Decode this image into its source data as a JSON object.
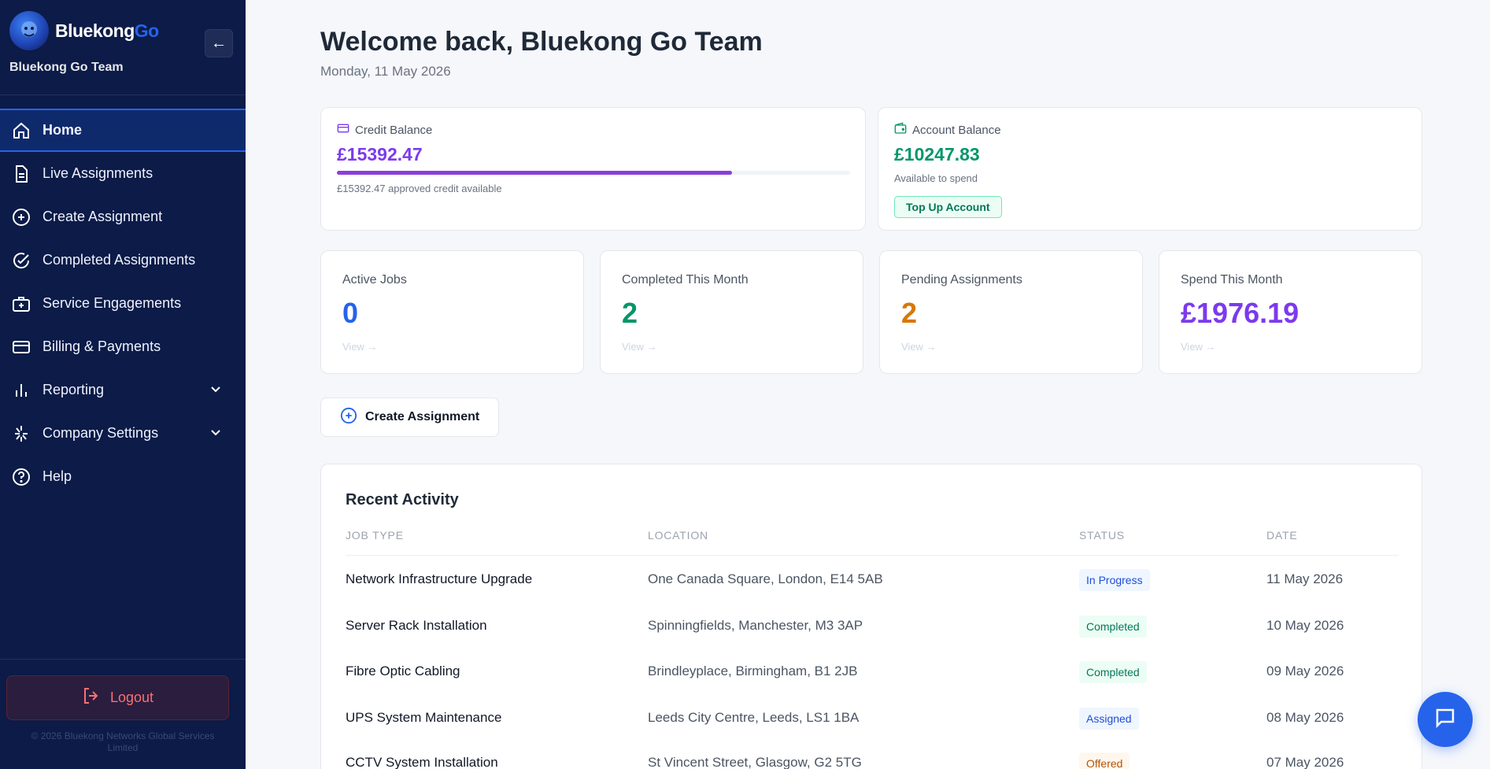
{
  "colors": {
    "sidebar_bg": "#0c1b47",
    "accent_blue": "#2563eb",
    "purple": "#7c3aed",
    "green": "#059669",
    "orange": "#d97706"
  },
  "sidebar": {
    "brand_primary": "Bluekong",
    "brand_accent": "Go",
    "team_name": "Bluekong Go Team",
    "collapse_label": "←",
    "items": [
      {
        "label": "Home",
        "icon": "home-icon",
        "active": true
      },
      {
        "label": "Live Assignments",
        "icon": "document-icon"
      },
      {
        "label": "Create Assignment",
        "icon": "plus-circle-icon"
      },
      {
        "label": "Completed Assignments",
        "icon": "check-circle-icon"
      },
      {
        "label": "Service Engagements",
        "icon": "briefcase-plus-icon"
      },
      {
        "label": "Billing & Payments",
        "icon": "credit-card-icon"
      },
      {
        "label": "Reporting",
        "icon": "bar-chart-icon",
        "expandable": true
      },
      {
        "label": "Company Settings",
        "icon": "settings-icon",
        "expandable": true
      },
      {
        "label": "Help",
        "icon": "help-circle-icon"
      }
    ],
    "logout_label": "Logout",
    "copyright_line1": "© 2026 Bluekong Networks Global Services",
    "copyright_line2": "Limited"
  },
  "header": {
    "welcome": "Welcome back, Bluekong Go Team",
    "date": "Monday, 11 May 2026"
  },
  "credit": {
    "label": "Credit Balance",
    "value": "£15392.47",
    "progress_fraction": 0.77,
    "sub": "£15392.47 approved credit available"
  },
  "account": {
    "label": "Account Balance",
    "value": "£10247.83",
    "sub": "Available to spend",
    "topup_label": "Top Up Account"
  },
  "stats": [
    {
      "label": "Active Jobs",
      "value": "0",
      "link": "View →",
      "color": "#2563eb"
    },
    {
      "label": "Completed This Month",
      "value": "2",
      "link": "View →",
      "color": "#059669"
    },
    {
      "label": "Pending Assignments",
      "value": "2",
      "link": "View →",
      "color": "#d97706"
    },
    {
      "label": "Spend This Month",
      "value": "£1976.19",
      "link": "View →",
      "color": "#7c3aed"
    }
  ],
  "create_button_label": "Create Assignment",
  "activity": {
    "title": "Recent Activity",
    "columns": [
      "JOB TYPE",
      "LOCATION",
      "STATUS",
      "DATE"
    ],
    "rows": [
      {
        "type": "Network Infrastructure Upgrade",
        "location": "One Canada Square, London, E14 5AB",
        "status": "In Progress",
        "date": "11 May 2026"
      },
      {
        "type": "Server Rack Installation",
        "location": "Spinningfields, Manchester, M3 3AP",
        "status": "Completed",
        "date": "10 May 2026"
      },
      {
        "type": "Fibre Optic Cabling",
        "location": "Brindleyplace, Birmingham, B1 2JB",
        "status": "Completed",
        "date": "09 May 2026"
      },
      {
        "type": "UPS System Maintenance",
        "location": "Leeds City Centre, Leeds, LS1 1BA",
        "status": "Assigned",
        "date": "08 May 2026"
      },
      {
        "type": "CCTV System Installation",
        "location": "St Vincent Street, Glasgow, G2 5TG",
        "status": "Offered",
        "date": "07 May 2026"
      }
    ]
  },
  "status_styles": {
    "In Progress": {
      "bg": "#eff6ff",
      "fg": "#1d4ed8"
    },
    "Completed": {
      "bg": "#ecfdf5",
      "fg": "#047857"
    },
    "Assigned": {
      "bg": "#eff6ff",
      "fg": "#1d4ed8"
    },
    "Offered": {
      "bg": "#fff7ed",
      "fg": "#b45309"
    }
  }
}
